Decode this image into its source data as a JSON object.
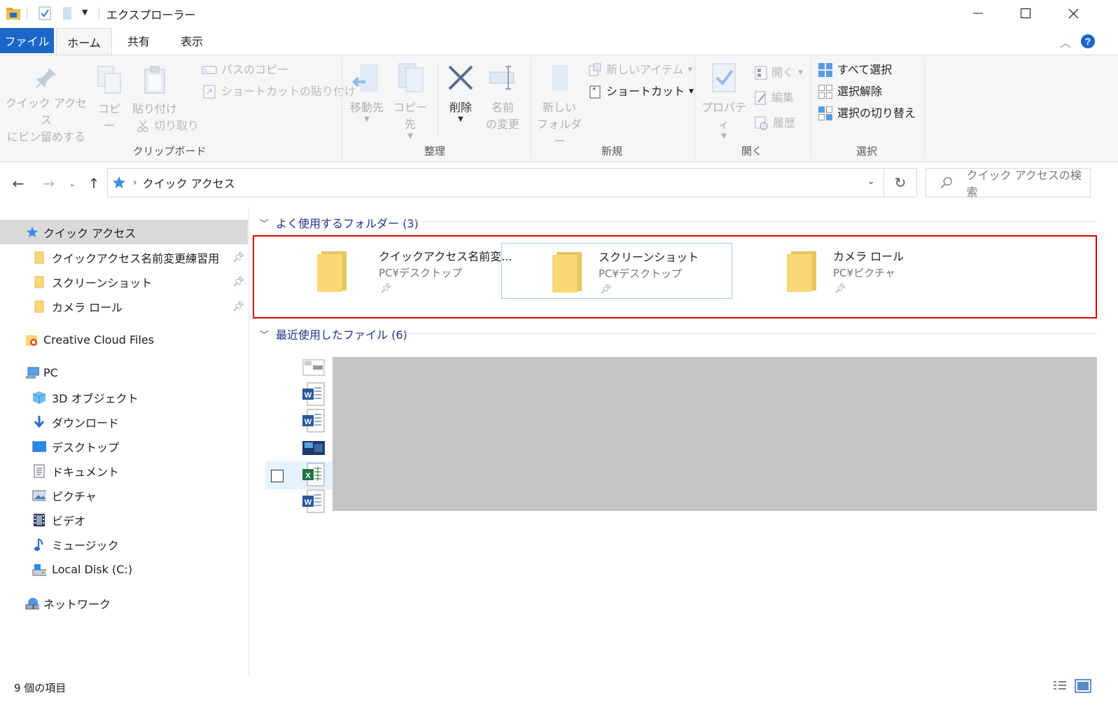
{
  "window": {
    "title": "エクスプローラー",
    "minimize_icon": "minimize-icon",
    "maximize_icon": "maximize-icon",
    "close_icon": "close-icon"
  },
  "ribbon_tabs": {
    "file": "ファイル",
    "home": "ホーム",
    "share": "共有",
    "view": "表示"
  },
  "ribbon": {
    "pin_quick_access": [
      "クイック アクセス",
      "にピン留めする"
    ],
    "copy": "コピー",
    "paste": "貼り付け",
    "copy_path": "パスのコピー",
    "paste_shortcut": "ショートカットの貼り付け",
    "cut": "切り取り",
    "group_clipboard": "クリップボード",
    "move_to": "移動先",
    "copy_to": "コピー先",
    "delete": "削除",
    "rename": [
      "名前",
      "の変更"
    ],
    "group_organize": "整理",
    "new_folder": [
      "新しい",
      "フォルダー"
    ],
    "new_item": "新しいアイテム",
    "easy_access": "ショートカット",
    "group_new": "新規",
    "properties": "プロパティ",
    "open": "開く",
    "edit": "編集",
    "history": "履歴",
    "group_open": "開く",
    "select_all": "すべて選択",
    "select_none": "選択解除",
    "invert_selection": "選択の切り替え",
    "group_select": "選択"
  },
  "address": {
    "path": "クイック アクセス",
    "search_placeholder": "クイック アクセスの検索"
  },
  "sidebar": {
    "quick_access": "クイック アクセス",
    "pinned": [
      "クイックアクセス名前変更練習用",
      "スクリーンショット",
      "カメラ ロール"
    ],
    "creative_cloud": "Creative Cloud Files",
    "pc": "PC",
    "pc_items": [
      "3D オブジェクト",
      "ダウンロード",
      "デスクトップ",
      "ドキュメント",
      "ピクチャ",
      "ビデオ",
      "ミュージック",
      "Local Disk (C:)"
    ],
    "network": "ネットワーク"
  },
  "content": {
    "frequent_header": "よく使用するフォルダー (3)",
    "recent_header": "最近使用したファイル (6)",
    "folders": [
      {
        "name": "クイックアクセス名前変...",
        "path": "PC¥デスクトップ"
      },
      {
        "name": "スクリーンショット",
        "path": "PC¥デスクトップ"
      },
      {
        "name": "カメラ ロール",
        "path": "PC¥ピクチャ"
      }
    ],
    "recent_icons": [
      "generic-file-icon",
      "word-file-icon",
      "word-file-icon",
      "image-file-icon",
      "excel-file-icon",
      "word-file-icon"
    ]
  },
  "status": {
    "item_count": "9 個の項目"
  },
  "colors": {
    "accent": "#1a67c9",
    "highlight_border": "#e00000",
    "folder": "#f8d775"
  }
}
